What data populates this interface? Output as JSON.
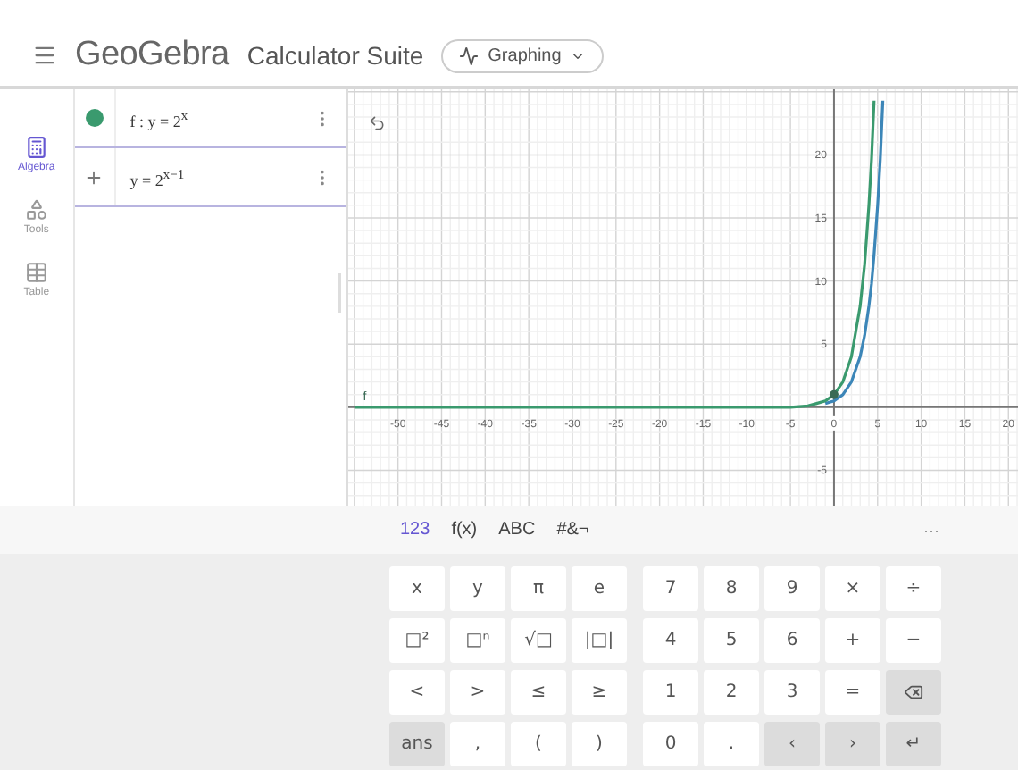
{
  "header": {
    "brand": "GeoGebra",
    "product": "Calculator Suite",
    "app_switch": "Graphing"
  },
  "sidebar": {
    "items": [
      {
        "label": "Algebra",
        "kind": "algebra",
        "selected": true
      },
      {
        "label": "Tools",
        "kind": "tools",
        "selected": false
      },
      {
        "label": "Table",
        "kind": "table",
        "selected": false
      }
    ]
  },
  "algebra": {
    "rows": [
      {
        "kind": "function",
        "expression": "f : y = 2$^{x}$",
        "visible": true,
        "color": "#3a9a6e"
      },
      {
        "kind": "input",
        "expression": "y = 2$^{x−1}$"
      }
    ]
  },
  "graph": {
    "chart_data": {
      "type": "line",
      "grid": true,
      "x": [
        -55,
        -50,
        -40,
        -30,
        -20,
        -10,
        -5,
        -3,
        -2,
        -1,
        0,
        1,
        2,
        3,
        3.5,
        4,
        4.3,
        4.6,
        5,
        5.3,
        5.6
      ],
      "series": [
        {
          "name": "f",
          "color": "#3a9a6e",
          "values": [
            0,
            0,
            0,
            0,
            0,
            0,
            0,
            0.1,
            0.3,
            0.5,
            1,
            2,
            4,
            8,
            11.3,
            16,
            19.7,
            24.3,
            null,
            null,
            null
          ]
        },
        {
          "color": "#3c86b8",
          "values": [
            null,
            null,
            null,
            null,
            null,
            null,
            null,
            null,
            null,
            0.3,
            0.5,
            1,
            2,
            4,
            5.7,
            8,
            9.8,
            12.1,
            16,
            19.7,
            24.3
          ]
        }
      ],
      "xlim": [
        -55.7,
        21.1
      ],
      "ylim": [
        -7.8,
        25.2
      ],
      "xticks": [
        -50,
        -45,
        -40,
        -35,
        -30,
        -25,
        -20,
        -15,
        -10,
        -5,
        0,
        5,
        10,
        15,
        20
      ],
      "yticks": [
        -5,
        5,
        10,
        15,
        20
      ]
    }
  },
  "keyboard": {
    "tabs": [
      {
        "label": "123",
        "selected": true
      },
      {
        "label": "f(x)",
        "selected": false
      },
      {
        "label": "ABC",
        "selected": false
      },
      {
        "label": "#&¬",
        "selected": false
      }
    ],
    "more": "···",
    "left_keys": [
      {
        "label": "x",
        "kind": "key"
      },
      {
        "label": "y",
        "kind": "key"
      },
      {
        "label": "π",
        "kind": "key"
      },
      {
        "label": "e",
        "kind": "key"
      },
      {
        "label": "□²",
        "kind": "key"
      },
      {
        "label": "□ⁿ",
        "kind": "key"
      },
      {
        "label": "√□",
        "kind": "key"
      },
      {
        "label": "|□|",
        "kind": "key"
      },
      {
        "label": "<",
        "kind": "key"
      },
      {
        "label": ">",
        "kind": "key"
      },
      {
        "label": "≤",
        "kind": "key"
      },
      {
        "label": "≥",
        "kind": "key"
      },
      {
        "label": "ans",
        "kind": "action"
      },
      {
        "label": ",",
        "kind": "key"
      },
      {
        "label": "(",
        "kind": "key"
      },
      {
        "label": ")",
        "kind": "key"
      }
    ],
    "right_keys": [
      {
        "label": "7",
        "kind": "key"
      },
      {
        "label": "8",
        "kind": "key"
      },
      {
        "label": "9",
        "kind": "key"
      },
      {
        "label": "×",
        "kind": "key"
      },
      {
        "label": "÷",
        "kind": "key"
      },
      {
        "label": "4",
        "kind": "key"
      },
      {
        "label": "5",
        "kind": "key"
      },
      {
        "label": "6",
        "kind": "key"
      },
      {
        "label": "+",
        "kind": "key"
      },
      {
        "label": "−",
        "kind": "key"
      },
      {
        "label": "1",
        "kind": "key"
      },
      {
        "label": "2",
        "kind": "key"
      },
      {
        "label": "3",
        "kind": "key"
      },
      {
        "label": "=",
        "kind": "key"
      },
      {
        "kind": "backspace"
      },
      {
        "label": "0",
        "kind": "key"
      },
      {
        "label": ".",
        "kind": "key"
      },
      {
        "label": "‹",
        "kind": "action"
      },
      {
        "label": "›",
        "kind": "action"
      },
      {
        "label": "↵",
        "kind": "action"
      }
    ]
  }
}
